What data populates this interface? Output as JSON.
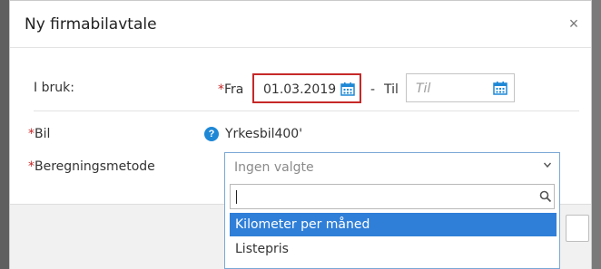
{
  "modal": {
    "title": "Ny firmabilavtale",
    "close_glyph": "×"
  },
  "in_use": {
    "label": "I bruk:",
    "from_required": "*",
    "from_label": "Fra",
    "from_value": "01.03.2019",
    "separator": "-",
    "to_label": "Til",
    "to_placeholder": "Til"
  },
  "car": {
    "required": "*",
    "label": "Bil",
    "help_glyph": "?",
    "value": "Yrkesbil400'"
  },
  "calc_method": {
    "required": "*",
    "label": "Beregningsmetode",
    "selected_text": "Ingen valgte",
    "search_value": "",
    "options": [
      "Kilometer per måned",
      "Listepris"
    ],
    "highlighted_index": 0
  },
  "colors": {
    "accent": "#2f7fd8",
    "required": "#c62828",
    "active_border": "#c62828"
  },
  "icons": {
    "calendar": "calendar-icon",
    "search": "search-icon",
    "chevron": "chevron-down-icon",
    "help": "help-icon",
    "close": "close-icon"
  }
}
